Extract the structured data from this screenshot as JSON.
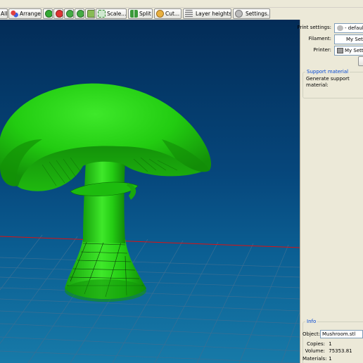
{
  "toolbar": {
    "delete_all_label": "All",
    "arrange_label": "Arrange",
    "scale_label": "Scale...",
    "split_label": "Split",
    "cut_label": "Cut...",
    "layer_heights_label": "Layer heights...",
    "settings_label": "Settings..."
  },
  "settings": {
    "print_settings_label": "Print settings:",
    "print_settings_value": "- default",
    "filament_label": "Filament:",
    "filament_value": "My Settings",
    "printer_label": "Printer:",
    "printer_value": "My Settings"
  },
  "support": {
    "title": "Support material",
    "text": "Generate support material:"
  },
  "info": {
    "title": "Info",
    "object_label": "Object:",
    "object_value": "Mushroom.stl",
    "copies_label": "Copies:",
    "copies_value": "1",
    "volume_label": "Volume:",
    "volume_value": "75353.81",
    "materials_label": "Materials:",
    "materials_value": "1"
  },
  "colors": {
    "model": "#22cc11",
    "background_top": "#032c57",
    "background_bottom": "#177aa8",
    "axis_line": "#dd1111"
  },
  "icons": [
    "arrange-icon",
    "add-icon",
    "remove-icon",
    "rotate-left-icon",
    "rotate-right-icon",
    "rotate-axis-icon",
    "scale-icon",
    "split-icon",
    "cut-icon",
    "layer-heights-icon",
    "settings-icon",
    "print-settings-icon",
    "printer-icon"
  ]
}
